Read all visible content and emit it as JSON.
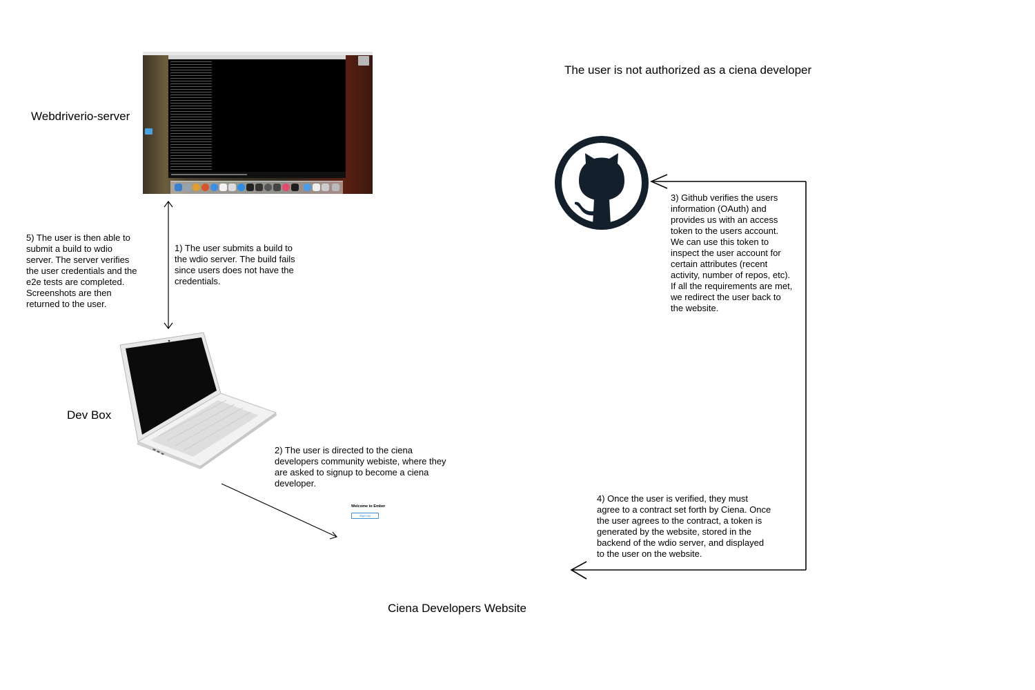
{
  "labels": {
    "webdriverio_server": "Webdriverio-server",
    "dev_box": "Dev Box",
    "not_authorized": "The user is not authorized as a ciena developer",
    "website": "Ciena Developers Website"
  },
  "steps": {
    "step1": "1) The user submits a build to\nthe wdio server. The build fails\nsince users does not have the\ncredentials.",
    "step2": "2) The user is directed to the ciena\ndevelopers community webiste, where they\nare asked to signup to become a ciena\ndeveloper.",
    "step3": "3) Github verifies the users\ninformation (OAuth) and\nprovides us with an access\ntoken to the users account.\nWe can use this token to\ninspect the user account for\ncertain attributes (recent\nactivity, number of repos, etc).\nIf all the requirements are met,\nwe redirect the user back to\nthe website.",
    "step4": "4) Once the user is verified, they must\nagree to a contract set forth by Ciena. Once\nthe user agrees to the contract, a token is\ngenerated by the website, stored in the\nbackend of the wdio server, and displayed\nto the user on the website.",
    "step5": "5) The user is then able to\nsubmit a build to wdio\nserver. The server verifies\nthe user credentials and the\ne2e tests are completed.\nScreenshots are then\nreturned to the user."
  },
  "website_preview": {
    "title": "Welcome to Ember",
    "button": "Sign Up"
  },
  "icons": {
    "server": "desktop-screenshot-icon",
    "devbox": "laptop-icon",
    "github": "github-octocat-icon"
  },
  "colors": {
    "line": "#000000",
    "github": "#13202c",
    "link_blue": "#3a8fd6"
  }
}
